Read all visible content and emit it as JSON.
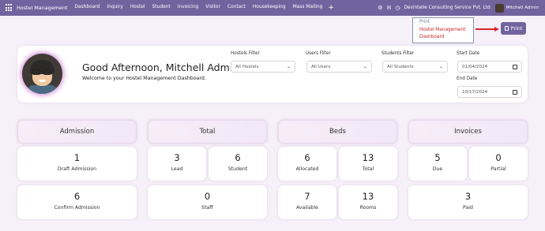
{
  "navbar": {
    "brand": "Hostel Management",
    "menu": [
      "Dashboard",
      "Inquiry",
      "Hostel",
      "Student",
      "Invoicing",
      "Visitor",
      "Contact",
      "Housekeeping",
      "Mass Mailing"
    ],
    "plus": "+",
    "company": "Devintelle Consulting Service Pvt. Ltd",
    "user": "Mitchell Admin",
    "bg_color": "#71639e"
  },
  "print_menu": {
    "title": "Print",
    "items": [
      "Hostel Management",
      "Dashboard"
    ]
  },
  "print_button": {
    "label": "Print"
  },
  "hero": {
    "greeting": "Good Afternoon, Mitchell Admin.",
    "welcome": "Welcome to your Hostel Management Dashboard."
  },
  "filters": {
    "hostels": {
      "label": "Hostels Filter",
      "value": "All Hostels"
    },
    "users": {
      "label": "Users Filter",
      "value": "All Users"
    },
    "students": {
      "label": "Students Filter",
      "value": "All Students"
    },
    "start_date": {
      "label": "Start Date",
      "value": "01/04/2024"
    },
    "end_date": {
      "label": "End Date",
      "value": "10/17/2024"
    }
  },
  "categories": [
    "Admission",
    "Total",
    "Beds",
    "Invoices"
  ],
  "stats": {
    "draft_admission": {
      "value": "1",
      "label": "Draft Admission"
    },
    "confirm_admission": {
      "value": "6",
      "label": "Confirm Admission"
    },
    "lead": {
      "value": "3",
      "label": "Lead"
    },
    "student": {
      "value": "6",
      "label": "Student"
    },
    "staff": {
      "value": "0",
      "label": "Staff"
    },
    "allocated": {
      "value": "6",
      "label": "Allocated"
    },
    "total_beds": {
      "value": "13",
      "label": "Total"
    },
    "available": {
      "value": "7",
      "label": "Available"
    },
    "rooms": {
      "value": "13",
      "label": "Rooms"
    },
    "due": {
      "value": "5",
      "label": "Due"
    },
    "partial": {
      "value": "0",
      "label": "Partial"
    },
    "paid": {
      "value": "3",
      "label": "Paid"
    }
  }
}
